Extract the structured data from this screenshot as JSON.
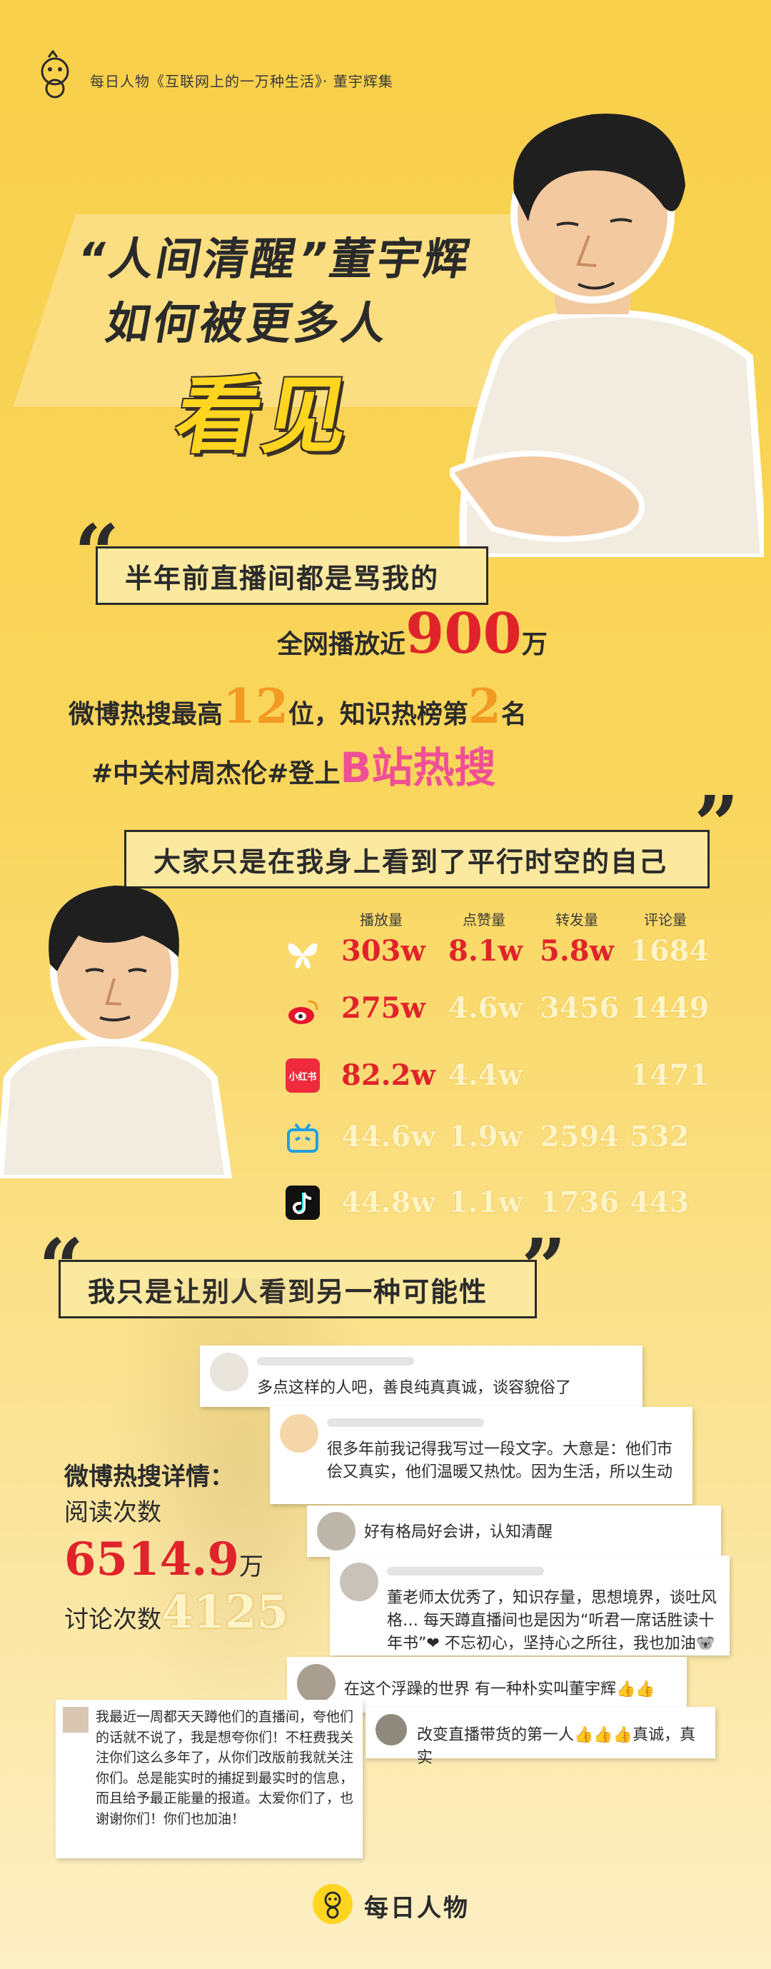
{
  "header": {
    "text": "每日人物《互联网上的一万种生活》· 董宇辉集"
  },
  "title": {
    "line1": "“人间清醒”董宇辉",
    "line2": "如何被更多人",
    "line3": "看见"
  },
  "quotes": {
    "q1": "半年前直播间都是骂我的",
    "q2": "大家只是在我身上看到了平行时空的自己",
    "q3": "我只是让别人看到另一种可能性"
  },
  "stats": {
    "line1_prefix": "全网播放近",
    "line1_value": "900",
    "line1_suffix": "万",
    "line2_prefix": "微博热搜最高",
    "line2_value1": "12",
    "line2_mid": "位，知识热榜第",
    "line2_value2": "2",
    "line2_suffix": "名",
    "line3_prefix": "#中关村周杰伦#登上",
    "line3_highlight": "B站热搜"
  },
  "table": {
    "headers": [
      "播放量",
      "点赞量",
      "转发量",
      "评论量"
    ],
    "rows": [
      {
        "platform_icon": "butterfly-icon",
        "play": "303w",
        "like": "8.1w",
        "share": "5.8w",
        "comment": "1684"
      },
      {
        "platform_icon": "weibo-icon",
        "play": "275w",
        "like": "4.6w",
        "share": "3456",
        "comment": "1449"
      },
      {
        "platform_icon": "xiaohongshu-icon",
        "icon_label": "小红书",
        "play": "82.2w",
        "like": "4.4w",
        "share": "",
        "comment": "1471"
      },
      {
        "platform_icon": "bilibili-icon",
        "play": "44.6w",
        "like": "1.9w",
        "share": "2594",
        "comment": "532"
      },
      {
        "platform_icon": "douyin-icon",
        "play": "44.8w",
        "like": "1.1w",
        "share": "1736",
        "comment": "443"
      }
    ]
  },
  "weibo": {
    "title": "微博热搜详情：",
    "read_label": "阅读次数",
    "read_value": "6514.9",
    "read_unit": "万",
    "discuss_label": "讨论次数",
    "discuss_value": "4125"
  },
  "comments": [
    "多点这样的人吧，善良纯真真诚，谈容貌俗了",
    "很多年前我记得我写过一段文字。大意是：他们市侩又真实，他们温暖又热忱。因为生活，所以生动",
    "好有格局好会讲，认知清醒",
    "董老师太优秀了，知识存量，思想境界，谈吐风格…  每天蹲直播间也是因为“听君一席话胜读十年书”❤ 不忘初心，坚持心之所往，我也加油🐨",
    "在这个浮躁的世界 有一种朴实叫董宇辉👍👍",
    "改变直播带货的第一人👍👍👍真诚，真实",
    "我最近一周都天天蹲他们的直播间，夸他们的话就不说了，我是想夸你们！不枉费我关注你们这么多年了，从你们改版前我就关注你们。总是能实时的捕捉到最实时的信息，而且给予最正能量的报道。太爱你们了，也谢谢你们！你们也加油！"
  ],
  "footer": {
    "brand": "每日人物"
  },
  "colors": {
    "background": "#f8cf4a",
    "red": "#e0232a",
    "orange": "#f29a21",
    "pink": "#ef4f94"
  }
}
